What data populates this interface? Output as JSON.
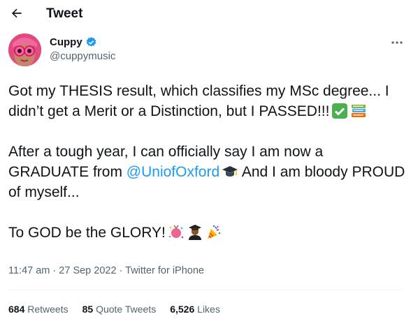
{
  "header": {
    "title": "Tweet"
  },
  "author": {
    "name": "Cuppy",
    "handle": "@cuppymusic"
  },
  "tweet": {
    "p1": "Got my THESIS result, which classifies my MSc degree... I didn’t get a Merit or a Distinction, but I PASSED!!!",
    "p2_before": "After a tough year, I can officially say I am now a GRADUATE from ",
    "p2_mention": "@UniofOxford",
    "p2_after": " And I am bloody PROUD of myself...",
    "p3": "To GOD be the GLORY!"
  },
  "meta": {
    "time": "11:47 am",
    "date": "27 Sep 2022",
    "source": "Twitter for iPhone",
    "sep": " · "
  },
  "stats": {
    "retweets_count": "684",
    "retweets_label": "Retweets",
    "quotes_count": "85",
    "quotes_label": "Quote Tweets",
    "likes_count": "6,526",
    "likes_label": "Likes"
  },
  "colors": {
    "accent": "#1d9bf0",
    "text": "#0f1419",
    "muted": "#536471"
  },
  "icons": [
    "back-arrow-icon",
    "verified-badge-icon",
    "more-icon",
    "check-emoji",
    "books-emoji",
    "graduation-cap-emoji",
    "confetti-emoji",
    "graduate-emoji",
    "party-popper-emoji"
  ]
}
